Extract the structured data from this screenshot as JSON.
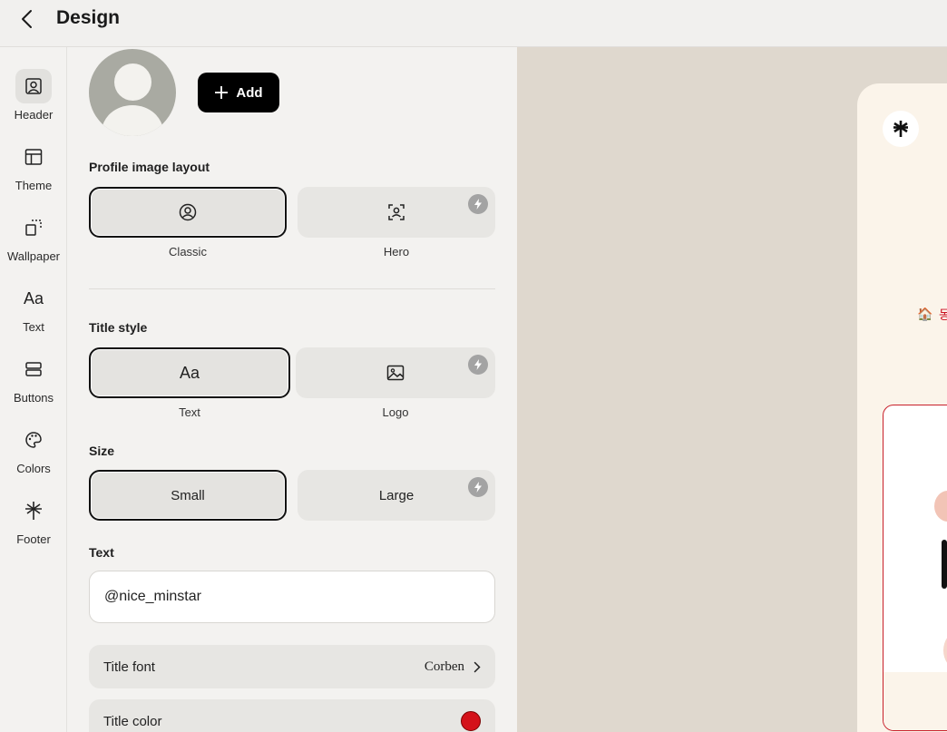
{
  "header": {
    "title": "Design"
  },
  "nav": {
    "items": [
      {
        "label": "Header",
        "icon": "header-icon",
        "active": true
      },
      {
        "label": "Theme",
        "icon": "theme-icon"
      },
      {
        "label": "Wallpaper",
        "icon": "wallpaper-icon"
      },
      {
        "label": "Text",
        "icon": "text-icon"
      },
      {
        "label": "Buttons",
        "icon": "buttons-icon"
      },
      {
        "label": "Colors",
        "icon": "palette-icon"
      },
      {
        "label": "Footer",
        "icon": "footer-icon"
      }
    ]
  },
  "profile": {
    "add_label": "Add",
    "layout_label": "Profile image layout",
    "layout_options": [
      "Classic",
      "Hero"
    ],
    "layout_selected": "Classic"
  },
  "title_style": {
    "label": "Title style",
    "options": [
      "Text",
      "Logo"
    ],
    "selected": "Text"
  },
  "size": {
    "label": "Size",
    "options": [
      "Small",
      "Large"
    ],
    "selected": "Small"
  },
  "text": {
    "label": "Text",
    "value": "@nice_minstar"
  },
  "title_font": {
    "label": "Title font",
    "value": "Corben"
  },
  "title_color": {
    "label": "Title color",
    "value": "#d4121a"
  },
  "preview": {
    "emoji": "🏠",
    "text_fragment": "동"
  },
  "colors": {
    "accent": "#000000",
    "selected_border": "#111111",
    "preview_bg": "#dfd8ce",
    "card_border": "#c8202a"
  }
}
